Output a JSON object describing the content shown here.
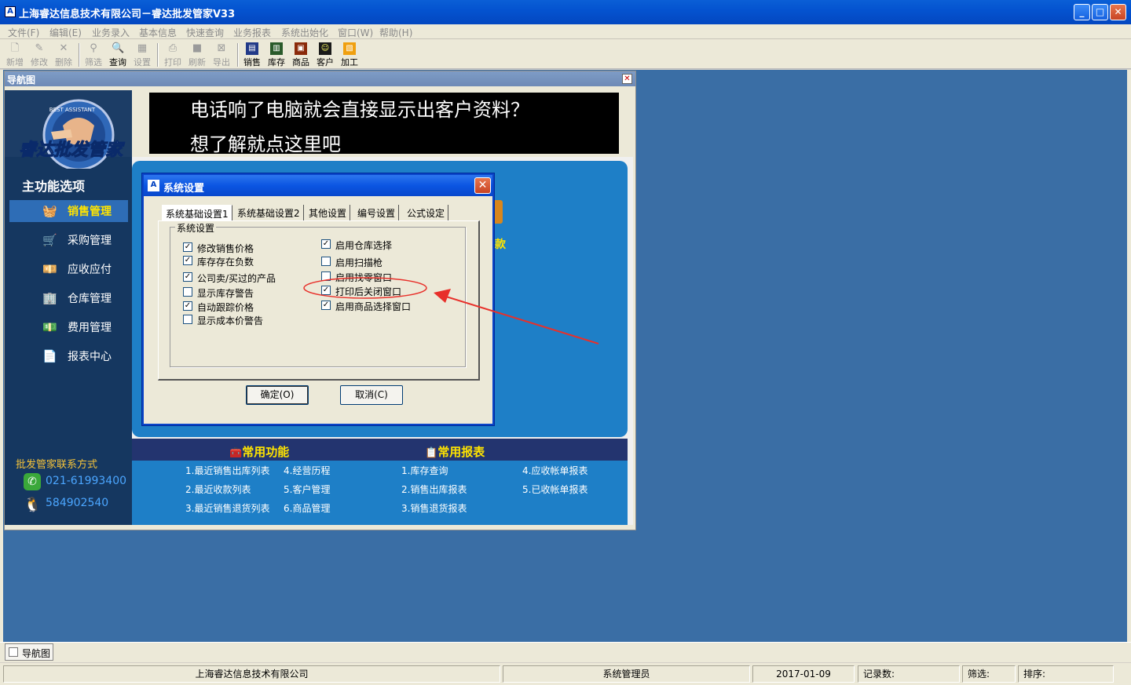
{
  "window": {
    "title": "上海睿达信息技术有限公司－睿达批发管家V33",
    "app_icon": "app-logo-icon"
  },
  "menu": [
    "文件(F)",
    "编辑(E)",
    "业务录入",
    "基本信息",
    "快速查询",
    "业务报表",
    "系统出始化",
    "窗口(W)",
    "帮助(H)"
  ],
  "toolbar": {
    "new": "新增",
    "edit": "修改",
    "delete": "删除",
    "filter": "筛选",
    "query": "查询",
    "settings": "设置",
    "print": "打印",
    "refresh": "刷新",
    "export": "导出",
    "sales": "销售",
    "stock": "库存",
    "goods": "商品",
    "customer": "客户",
    "process": "加工"
  },
  "nav_window": {
    "title": "导航图"
  },
  "logo_text": "睿达批发管家",
  "banner": {
    "line1": "电话响了电脑就会直接显示出客户资料？",
    "line2": "想了解就点这里吧"
  },
  "sidebar": {
    "title": "主功能选项",
    "items": [
      {
        "label": "销售管理",
        "icon": "basket-icon",
        "active": true
      },
      {
        "label": "采购管理",
        "icon": "cart-icon"
      },
      {
        "label": "应收应付",
        "icon": "money-icon"
      },
      {
        "label": "仓库管理",
        "icon": "warehouse-icon"
      },
      {
        "label": "费用管理",
        "icon": "expense-icon"
      },
      {
        "label": "报表中心",
        "icon": "report-icon"
      }
    ],
    "contact_title": "批发管家联系方式",
    "phone": "021-61993400",
    "qq": "584902540"
  },
  "main_partial_text": "款",
  "common_functions": {
    "title": "常用功能",
    "items": [
      "1.最近销售出库列表",
      "2.最近收款列表",
      "3.最近销售退货列表",
      "4.经营历程",
      "5.客户管理",
      "6.商品管理"
    ]
  },
  "common_reports": {
    "title": "常用报表",
    "items": [
      "1.库存查询",
      "2.销售出库报表",
      "3.销售退货报表",
      "4.应收帐单报表",
      "5.已收帐单报表"
    ]
  },
  "dialog": {
    "title": "系统设置",
    "tabs": [
      "系统基础设置1",
      "系统基础设置2",
      "其他设置",
      "编号设置",
      "公式设定"
    ],
    "group_label": "系统设置",
    "left_options": [
      {
        "label": "修改销售价格",
        "checked": true
      },
      {
        "label": "库存存在负数",
        "checked": true
      },
      {
        "label": "公司卖/买过的产品",
        "checked": true
      },
      {
        "label": "显示库存警告",
        "checked": false
      },
      {
        "label": "自动跟踪价格",
        "checked": true
      },
      {
        "label": "显示成本价警告",
        "checked": false
      }
    ],
    "right_options": [
      {
        "label": "启用仓库选择",
        "checked": true
      },
      {
        "label": "启用扫描枪",
        "checked": false
      },
      {
        "label": "启用找零窗口",
        "checked": false
      },
      {
        "label": "打印后关闭窗口",
        "checked": true
      },
      {
        "label": "启用商品选择窗口",
        "checked": true
      }
    ],
    "ok": "确定(O)",
    "cancel": "取消(C)"
  },
  "annotation_color": "#e8302a",
  "taskbar": {
    "tab": "导航图"
  },
  "status": {
    "company": "上海睿达信息技术有限公司",
    "user": "系统管理员",
    "date": "2017-01-09",
    "records": "记录数:",
    "filter": "筛选:",
    "sort": "排序:"
  }
}
